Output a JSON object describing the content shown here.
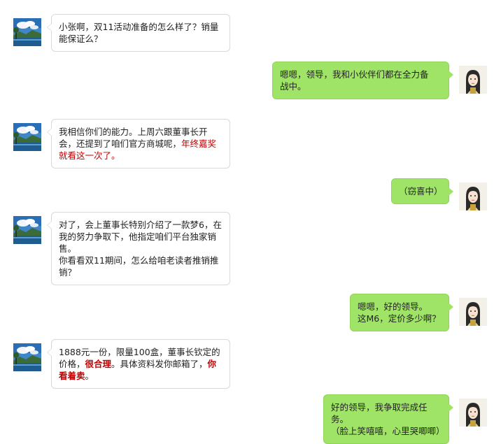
{
  "colors": {
    "outgoing_bubble": "#9fe466",
    "incoming_bubble": "#ffffff",
    "highlight": "#c00000"
  },
  "messages": [
    {
      "side": "left",
      "lines": [
        [
          {
            "t": "小张啊，双11活动准备的怎么样了？销量"
          }
        ],
        [
          {
            "t": "能保证么？"
          }
        ]
      ]
    },
    {
      "side": "right",
      "lines": [
        [
          {
            "t": "嗯嗯，领导，我和小伙伴们都在全力备"
          }
        ],
        [
          {
            "t": "战中。"
          }
        ]
      ]
    },
    {
      "side": "left",
      "lines": [
        [
          {
            "t": "我相信你们的能力。上周六跟董事长开"
          }
        ],
        [
          {
            "t": "会，还提到了咱们官方商城呢，"
          },
          {
            "t": "年终嘉奖",
            "s": "red"
          }
        ],
        [
          {
            "t": "就看这一次了。",
            "s": "red"
          }
        ]
      ]
    },
    {
      "side": "right",
      "lines": [
        [
          {
            "t": "（窃喜中）"
          }
        ]
      ]
    },
    {
      "side": "left",
      "lines": [
        [
          {
            "t": "对了，会上董事长特别介绍了一款梦6，在"
          }
        ],
        [
          {
            "t": "我的努力争取下，他指定咱们平台独家销"
          }
        ],
        [
          {
            "t": "售。"
          }
        ],
        [
          {
            "t": "你看看双11期间，怎么给咱老读者推销推"
          }
        ],
        [
          {
            "t": "销？"
          }
        ]
      ]
    },
    {
      "side": "right",
      "lines": [
        [
          {
            "t": "嗯嗯，好的领导。"
          }
        ],
        [
          {
            "t": "这M6，定价多少啊？"
          }
        ]
      ]
    },
    {
      "side": "left",
      "lines": [
        [
          {
            "t": "1888元一份，限量100盒，董事长钦定的"
          }
        ],
        [
          {
            "t": "价格，"
          },
          {
            "t": "很合理",
            "s": "red bold"
          },
          {
            "t": "。具体资料发你邮箱了，"
          },
          {
            "t": "你",
            "s": "red bold"
          }
        ],
        [
          {
            "t": "看着卖",
            "s": "red bold"
          },
          {
            "t": "。"
          }
        ]
      ]
    },
    {
      "side": "right",
      "lines": [
        [
          {
            "t": "好的领导，我争取完成任务。"
          }
        ],
        [
          {
            "t": "（脸上笑嘻嘻，心里哭唧唧）"
          }
        ]
      ]
    }
  ]
}
